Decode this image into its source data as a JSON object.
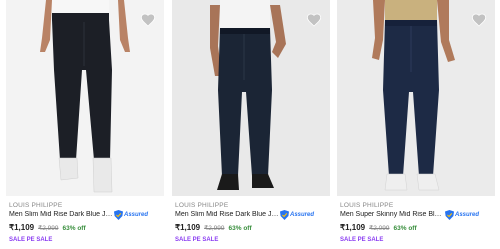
{
  "products": [
    {
      "brand": "LOUIS PHILIPPE",
      "title": "Men Slim Mid Rise Dark Blue Je...",
      "assured_label": "Assured",
      "price": "₹1,109",
      "mrp": "₹2,999",
      "discount": "63% off",
      "badge": "SALE PE SALE",
      "image_icon": "jeans-product-image",
      "colors": {
        "jeans": "#1c1f26",
        "shirt": "#f7f7f7",
        "shoes": "#e9e9e9",
        "skin": "#b98366"
      }
    },
    {
      "brand": "LOUIS PHILIPPE",
      "title": "Men Slim Mid Rise Dark Blue Je...",
      "assured_label": "Assured",
      "price": "₹1,109",
      "mrp": "₹2,999",
      "discount": "63% off",
      "badge": "SALE PE SALE",
      "image_icon": "jeans-product-image",
      "colors": {
        "jeans": "#1b2535",
        "shirt": "#f4f4f4",
        "shoes": "#1a1a1a",
        "skin": "#a87458"
      }
    },
    {
      "brand": "LOUIS PHILIPPE",
      "title": "Men Super Skinny Mid Rise Blue...",
      "assured_label": "Assured",
      "price": "₹1,109",
      "mrp": "₹2,099",
      "discount": "63% off",
      "badge": "SALE PE SALE",
      "image_icon": "jeans-product-image",
      "colors": {
        "jeans": "#1d2a45",
        "shirt": "#c9b17e",
        "shoes": "#efefef",
        "skin": "#b07a5b"
      }
    }
  ],
  "theme": {
    "wishlist_icon_color": "#c2c2c2",
    "assured_color": "#2874f0",
    "discount_color": "#388e3c",
    "badge_color": "#8b3df2"
  }
}
